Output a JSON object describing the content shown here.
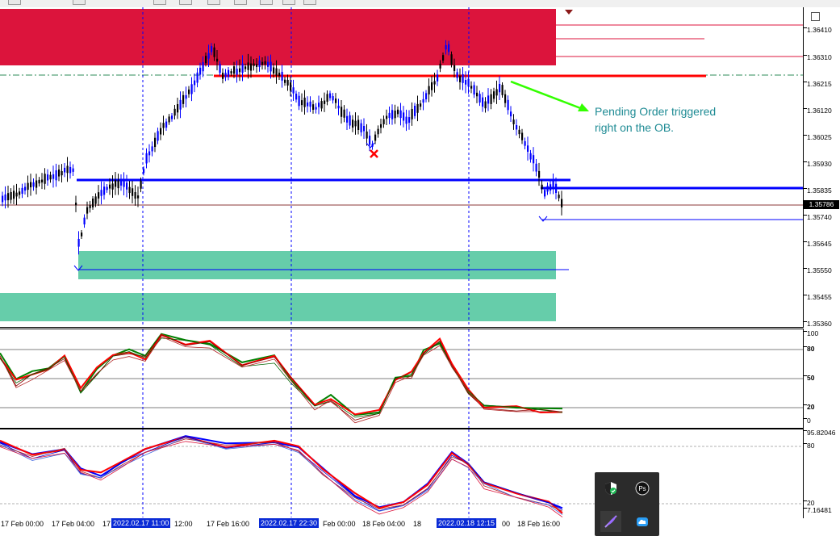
{
  "main_price_labels": [
    "1.36410",
    "1.36310",
    "1.36215",
    "1.36120",
    "1.36025",
    "1.35930",
    "1.35835",
    "1.35740",
    "1.35645",
    "1.35550",
    "1.35455",
    "1.35360"
  ],
  "current_price": "1.35786",
  "stoch_labels": [
    "100",
    "80",
    "50",
    "20",
    "0"
  ],
  "macd_labels": [
    "95.82046",
    "80",
    "20",
    "7.16481"
  ],
  "time_labels": [
    {
      "text": "17 Feb 00:00",
      "highlight": false
    },
    {
      "text": "17 Feb 04:00",
      "highlight": false
    },
    {
      "text": "17",
      "highlight": false
    },
    {
      "text": "2022.02.17 11:00",
      "highlight": true
    },
    {
      "text": "12:00",
      "highlight": false
    },
    {
      "text": "17 Feb 16:00",
      "highlight": false
    },
    {
      "text": "2022.02.17 22:30",
      "highlight": true
    },
    {
      "text": "Feb 00:00",
      "highlight": false
    },
    {
      "text": "18 Feb 04:00",
      "highlight": false
    },
    {
      "text": "18",
      "highlight": false
    },
    {
      "text": "2022.02.18 12:15",
      "highlight": true
    },
    {
      "text": "00",
      "highlight": false
    },
    {
      "text": "18 Feb 16:00",
      "highlight": false
    }
  ],
  "annotation": "Pending Order triggered\nright on the OB.",
  "colors": {
    "supply_zone": "#dc143c",
    "demand_zone": "#66cdaa",
    "bull_candle": "#0000ff",
    "bear_candle": "#000000",
    "ob_line": "#0000ff",
    "arrow": "#33ff00",
    "annotation_text": "#1e8b94"
  },
  "tray_icons": [
    "shield-check-icon",
    "ps-circle-icon",
    "feather-icon",
    "cloud-icon"
  ]
}
